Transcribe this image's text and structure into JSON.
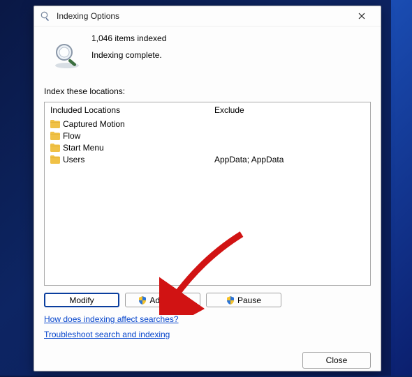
{
  "window": {
    "title": "Indexing Options"
  },
  "status": {
    "count_line": "1,046 items indexed",
    "state_line": "Indexing complete."
  },
  "sections": {
    "locations_label": "Index these locations:",
    "included_header": "Included Locations",
    "exclude_header": "Exclude"
  },
  "locations": [
    {
      "name": "Captured Motion",
      "exclude": ""
    },
    {
      "name": "Flow",
      "exclude": ""
    },
    {
      "name": "Start Menu",
      "exclude": ""
    },
    {
      "name": "Users",
      "exclude": "AppData; AppData"
    }
  ],
  "buttons": {
    "modify": "Modify",
    "advanced": "Advanced",
    "pause": "Pause",
    "close": "Close"
  },
  "links": {
    "how": "How does indexing affect searches?",
    "troubleshoot": "Troubleshoot search and indexing"
  }
}
